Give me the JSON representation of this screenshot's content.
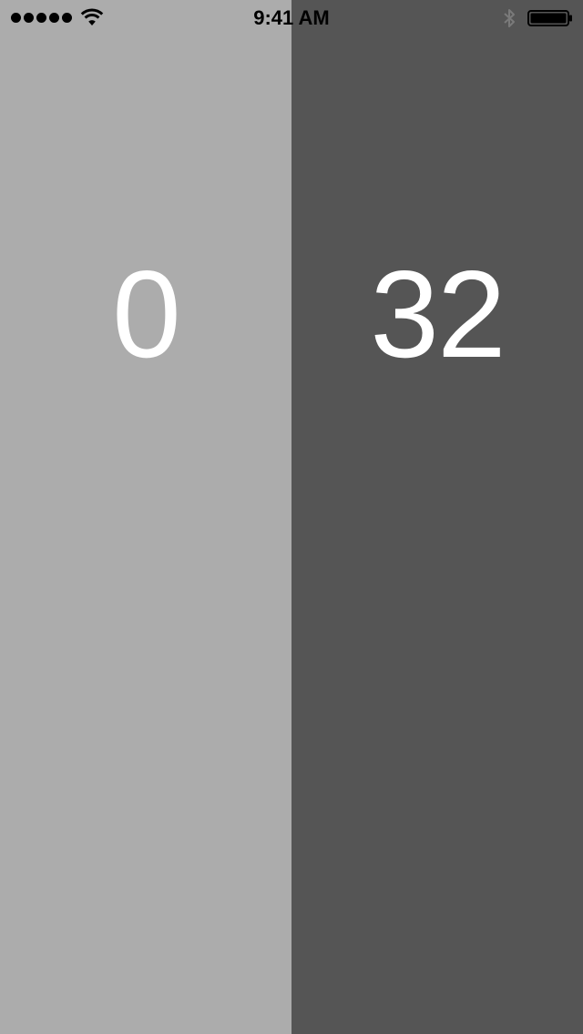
{
  "status_bar": {
    "time": "9:41 AM",
    "signal_dots": 5,
    "icons": [
      "signal-dots-icon",
      "wifi-icon",
      "bluetooth-icon",
      "battery-icon"
    ]
  },
  "players": [
    {
      "score": "0",
      "background": "#acacac"
    },
    {
      "score": "32",
      "background": "#555555"
    }
  ],
  "colors": {
    "score_text": "#ffffff",
    "status_text": "#000000"
  }
}
